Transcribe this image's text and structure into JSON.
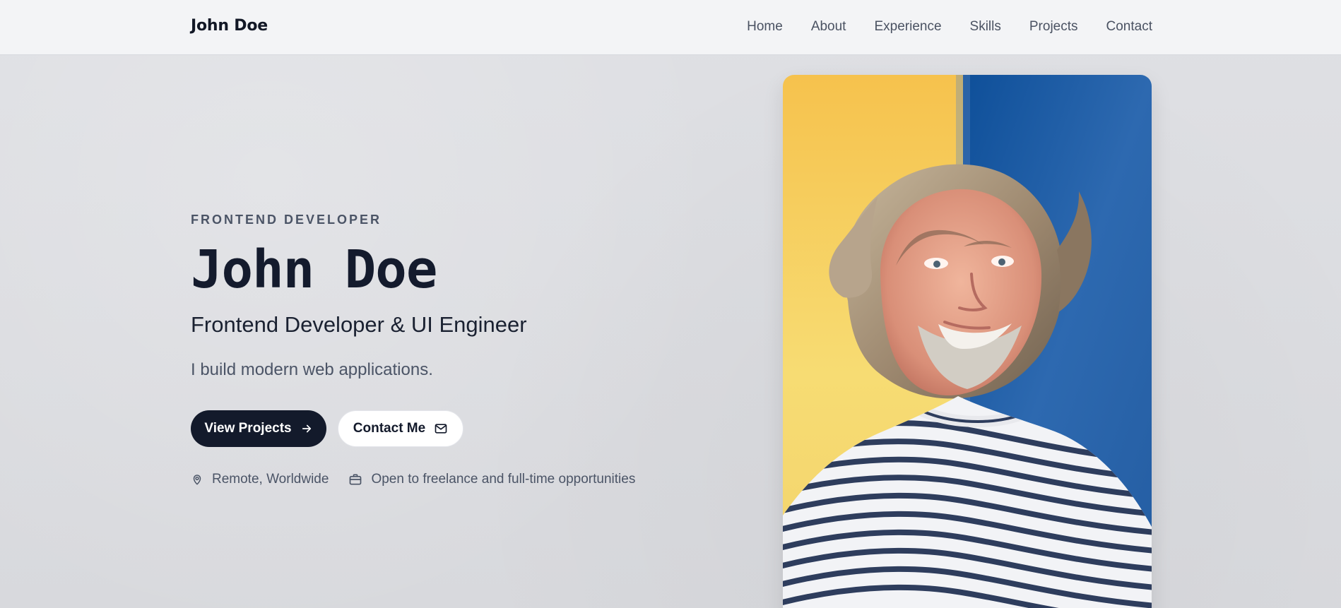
{
  "brand": {
    "name": "John Doe"
  },
  "nav": {
    "items": [
      {
        "label": "Home"
      },
      {
        "label": "About"
      },
      {
        "label": "Experience"
      },
      {
        "label": "Skills"
      },
      {
        "label": "Projects"
      },
      {
        "label": "Contact"
      }
    ]
  },
  "hero": {
    "eyebrow": "FRONTEND DEVELOPER",
    "title": "John Doe",
    "subtitle": "Frontend Developer & UI Engineer",
    "description": "I build modern web applications.",
    "primary_button": "View Projects",
    "secondary_button": "Contact Me",
    "location": "Remote, Worldwide",
    "availability": "Open to freelance and full-time opportunities"
  },
  "icons": {
    "arrow": "arrow-right-icon",
    "mail": "mail-icon",
    "location": "map-pin-icon",
    "briefcase": "briefcase-icon"
  },
  "colors": {
    "background": "#dcdde1",
    "header": "#f3f4f6",
    "primary": "#131a2b",
    "secondary": "#ffffff",
    "muted_text": "#4b5466",
    "photo_left": "#f4c64c",
    "photo_right": "#2f63a9"
  }
}
